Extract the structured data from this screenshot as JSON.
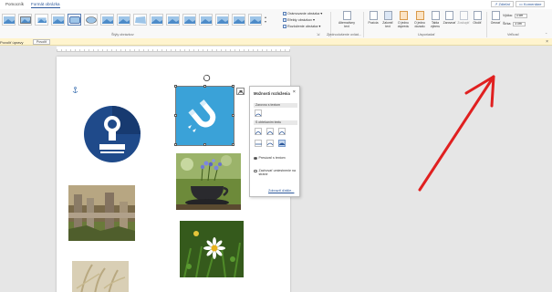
{
  "ribbon": {
    "tabs": [
      "Pomocník",
      "Formát obrázka"
    ],
    "active_tab": "Formát obrázka",
    "share": "Zdieľať",
    "comments": "Komentáre",
    "groups": {
      "styles": "Štýly obrázkov",
      "accessibility": "Zjednodušenie ovlád...",
      "arrange": "Usporiadať",
      "size": "Veľkosť"
    },
    "style_commands": [
      "Orámovanie obrázka",
      "Efekty obrázkov",
      "Rozloženie obrázka"
    ],
    "alt_text": "Alternatívny text",
    "arrange_buttons": [
      "Pozícia",
      "Zalomiť text",
      "O jednu dopredu",
      "O jednu dozadu",
      "Tabla výberu",
      "Zarovnať",
      "Zoskupiť",
      "Otočiť"
    ],
    "crop": "Orezať",
    "height_label": "Výška:",
    "width_label": "Šírka:",
    "height_value": "3 cm",
    "width_value": "3 cm"
  },
  "message_bar": {
    "text": "Povoliť úpravy",
    "button": "Povoliť",
    "close": "×"
  },
  "layout_popup": {
    "title": "Možnosti rozloženia",
    "close": "×",
    "inline_section": "Zarovno s textom",
    "wrap_section": "S obtekaním textu",
    "move_with_text": "Presúvať s textom",
    "fix_position": "Zachovať umiestnenie na strane",
    "more": "Zobraziť ďalšie..."
  },
  "colors": {
    "accent": "#2b579a",
    "annotation_arrow": "#e02020",
    "magnet_tile": "#3aa2d8",
    "circle_icon_bg": "#1f4a8a"
  },
  "icons": [
    "anchor-icon",
    "rotate-handle-icon",
    "layout-options-icon",
    "magnet-icon",
    "stamp-icon"
  ]
}
